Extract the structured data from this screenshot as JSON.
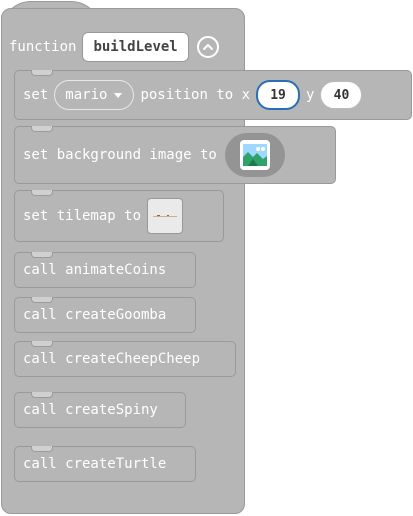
{
  "function_block": {
    "keyword": "function",
    "name": "buildLevel",
    "color": "#b6b6b6"
  },
  "statements": {
    "position": {
      "prefix": "set",
      "sprite": "mario",
      "middle": "position to x",
      "x_value": "19",
      "y_label": "y",
      "y_value": "40"
    },
    "background": {
      "label": "set background image to",
      "icon": "landscape-image-icon"
    },
    "tilemap": {
      "label": "set tilemap to",
      "icon": "tilemap-thumbnail-icon"
    },
    "calls": [
      "call animateCoins",
      "call createGoomba",
      "call createCheepCheep",
      "call createSpiny",
      "call createTurtle"
    ]
  }
}
